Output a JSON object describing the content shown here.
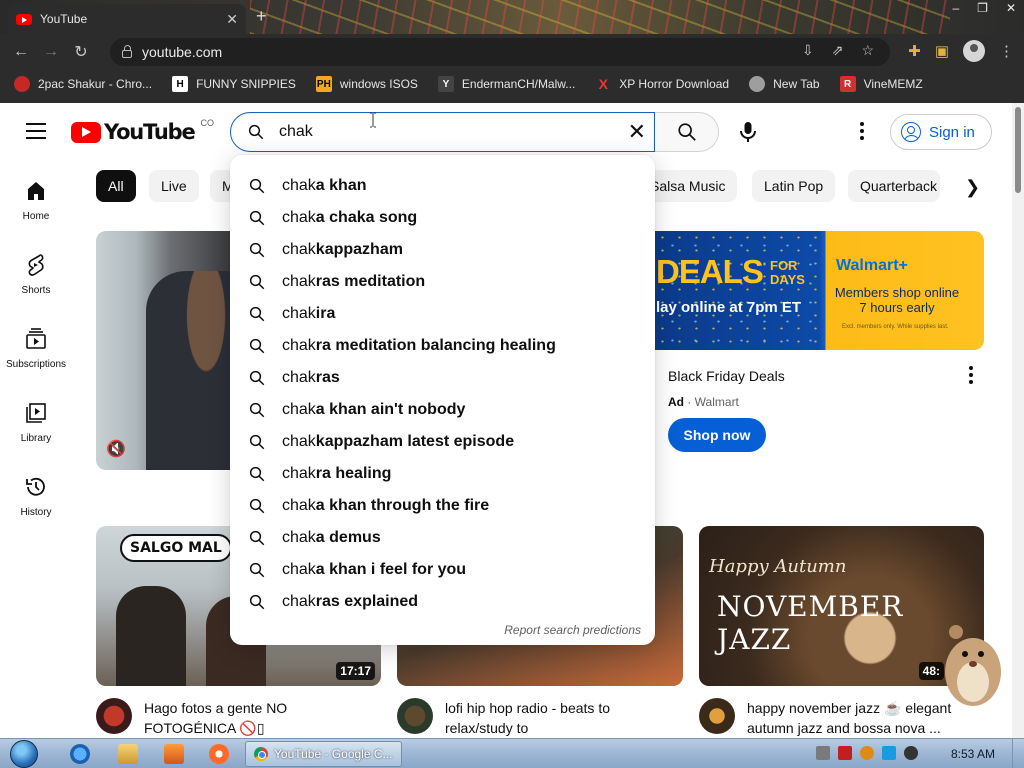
{
  "browser": {
    "tab_title": "YouTube",
    "tab_close": "✕",
    "new_tab": "+",
    "window_controls": [
      "–",
      "❐",
      "✕"
    ],
    "url": "youtube.com",
    "bookmarks": [
      {
        "label": "2pac Shakur - Chro...",
        "icon": "2pac-favicon",
        "color": "#c62828"
      },
      {
        "label": "FUNNY SNIPPIES",
        "icon": "h-favicon",
        "color": "#ffffff"
      },
      {
        "label": "windows ISOS",
        "icon": "ph-favicon",
        "color": "#f5a623"
      },
      {
        "label": "EndermanCH/Malw...",
        "icon": "github-favicon",
        "color": "#444444"
      },
      {
        "label": "XP Horror Download",
        "icon": "x-favicon",
        "color": "#e53935"
      },
      {
        "label": "New Tab",
        "icon": "chrome-favicon",
        "color": "#9e9e9e"
      },
      {
        "label": "VineMEMZ",
        "icon": "r-favicon",
        "color": "#d32f2f"
      }
    ]
  },
  "header": {
    "logo_text": "YouTube",
    "logo_country": "CO",
    "search_value": "chak",
    "signin_label": "Sign in"
  },
  "sidebar": {
    "items": [
      {
        "label": "Home",
        "icon": "home-icon"
      },
      {
        "label": "Shorts",
        "icon": "shorts-icon"
      },
      {
        "label": "Subscriptions",
        "icon": "subscriptions-icon"
      },
      {
        "label": "Library",
        "icon": "library-icon"
      },
      {
        "label": "History",
        "icon": "history-icon"
      }
    ]
  },
  "chips": [
    "All",
    "Live",
    "M",
    "Salsa Music",
    "Latin Pop",
    "Quarterback"
  ],
  "suggestions": {
    "typed": "chak",
    "items": [
      {
        "rest": "a khan"
      },
      {
        "rest": "a chaka song"
      },
      {
        "rest": "kappazham"
      },
      {
        "rest": "ras meditation"
      },
      {
        "rest": "ira"
      },
      {
        "rest": "ra meditation balancing healing"
      },
      {
        "rest": "ras"
      },
      {
        "rest": "a khan ain't nobody"
      },
      {
        "rest": "kappazham latest episode"
      },
      {
        "rest": "ra healing"
      },
      {
        "rest": "a khan through the fire"
      },
      {
        "rest": "a demus"
      },
      {
        "rest": "a khan i feel for you"
      },
      {
        "rest": "ras explained"
      }
    ],
    "report_label": "Report search predictions"
  },
  "ad": {
    "banner_deals": "DEALS",
    "banner_for_days": "FOR DAYS",
    "banner_time": "lay online at 7pm ET",
    "banner_walmart": "Walmart+",
    "banner_members": "Members shop online 7 hours early",
    "banner_fine": "Excl. members only. While supplies last.",
    "title": "Black Friday Deals",
    "ad_label": "Ad",
    "advertiser": "Walmart",
    "cta": "Shop now"
  },
  "videos": [
    {
      "title": "Hago fotos a gente NO FOTOGÉNICA 🚫▯",
      "duration": "17:17",
      "thumb_text": "SALGO MAL"
    },
    {
      "title": "lofi hip hop radio - beats to relax/study to",
      "duration": ""
    },
    {
      "title": "happy november jazz ☕ elegant autumn jazz and bossa nova ...",
      "duration": "48:",
      "thumb_text_1": "Happy Autumn",
      "thumb_text_2": "NOVEMBER JAZZ"
    }
  ],
  "taskbar": {
    "task_label": "YouTube - Google C...",
    "clock": "8:53 AM"
  },
  "colors": {
    "brand_red": "#ff0000",
    "link_blue": "#065fd4",
    "search_border": "#1c62b9",
    "walmart_blue": "#0071dc",
    "walmart_yellow": "#ffc220"
  }
}
